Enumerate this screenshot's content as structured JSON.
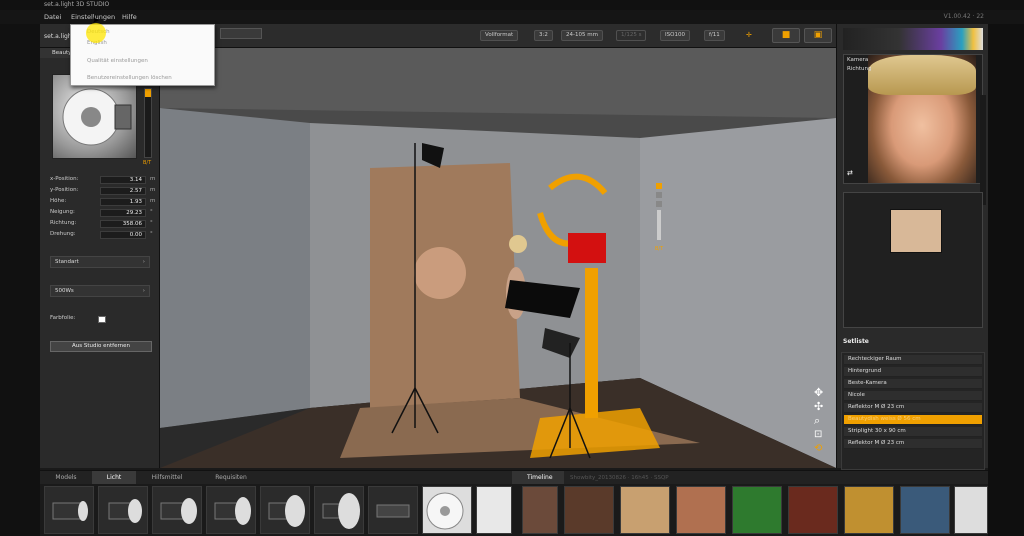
{
  "window": {
    "title": "set.a.light 3D STUDIO",
    "version": "V1.00.42 · 22"
  },
  "menu": {
    "items": [
      "Datei",
      "Einstellungen",
      "Hilfe"
    ]
  },
  "dropdown": {
    "items": [
      "Deutsch",
      "English",
      "Qualität einstellungen",
      "Benutzereinstellungen löschen"
    ]
  },
  "toolbar": {
    "panel_label": "set.a.light",
    "format": "Vollformat",
    "ratio": "3:2",
    "lens": "24-105 mm",
    "shutter": "1/125 s",
    "iso": "ISO100",
    "aperture": "f/11",
    "camera_icon": "camera-icon",
    "multi_camera_icon": "camera-multi-icon"
  },
  "left_panel": {
    "header": "Beauty",
    "slider_value": "B/T",
    "params": [
      {
        "label": "x-Position:",
        "value": "3.14",
        "unit": "m"
      },
      {
        "label": "y-Position:",
        "value": "2.57",
        "unit": "m"
      },
      {
        "label": "Höhe:",
        "value": "1.93",
        "unit": "m"
      },
      {
        "label": "Neigung:",
        "value": "29.23",
        "unit": "°"
      },
      {
        "label": "Richtung:",
        "value": "358.06",
        "unit": "°"
      },
      {
        "label": "Drehung:",
        "value": "0.00",
        "unit": "°"
      }
    ],
    "modifier_select": "Standart",
    "power_select": "500Ws",
    "colorfilter_label": "Farbfolie:",
    "remove_button": "Aus Studio entfernen"
  },
  "viewport": {
    "slider_label": "B/T"
  },
  "right_panel": {
    "camera_label": "Kamera",
    "focus_label": "Richtung",
    "setlist_header": "Setliste",
    "setlist": [
      "Rechteckiger Raum",
      "Hintergrund",
      "Beste-Kamera",
      "Nicole",
      "Reflektor M Ø 23 cm",
      "Beautydish weiss Ø 56 cm",
      "Striplight 30 x 90 cm",
      "Reflektor M Ø 23 cm"
    ],
    "selected_index": 5
  },
  "bottom": {
    "tabs": [
      "Models",
      "Licht",
      "Hilfsmittel",
      "Requisiten"
    ],
    "active_tab": "Licht",
    "timeline_label": "Timeline",
    "timeline_info": "Showbity_20130826 · 16h45 · SSQP"
  },
  "colors": {
    "accent": "#f0a000",
    "selected": "#f0a000",
    "background": "#1a1a1a"
  }
}
